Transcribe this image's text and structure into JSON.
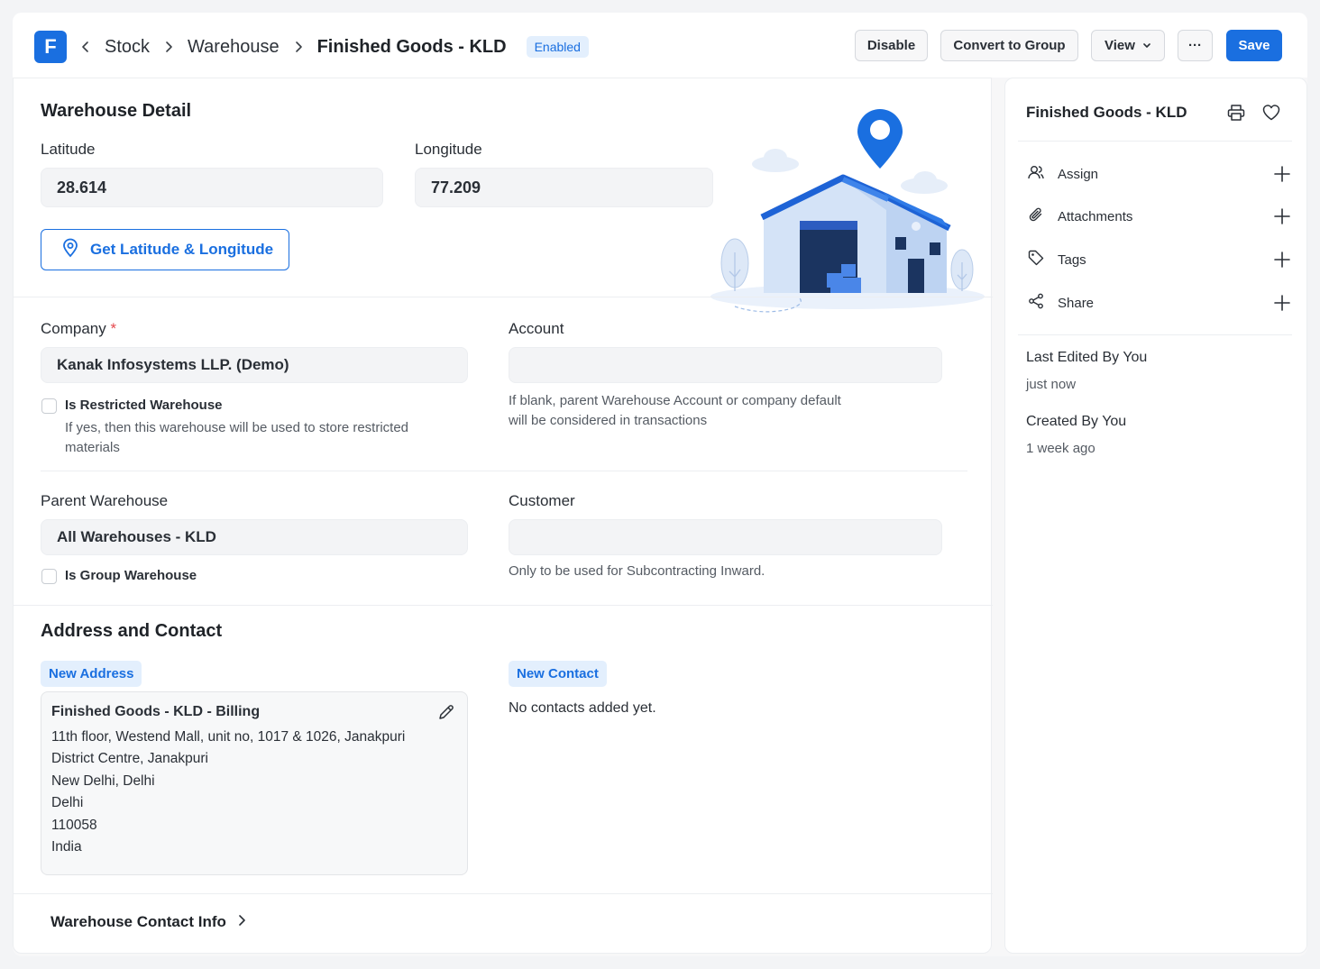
{
  "header": {
    "logo_letter": "F",
    "breadcrumbs": [
      "Stock",
      "Warehouse",
      "Finished Goods - KLD"
    ],
    "status": "Enabled",
    "buttons": {
      "disable": "Disable",
      "convert": "Convert to Group",
      "view": "View",
      "more": "···",
      "save": "Save"
    }
  },
  "warehouse_detail": {
    "title": "Warehouse Detail",
    "latitude_label": "Latitude",
    "latitude_value": "28.614",
    "longitude_label": "Longitude",
    "longitude_value": "77.209",
    "get_coords_button": "Get Latitude & Longitude"
  },
  "company_section": {
    "company_label": "Company",
    "required_mark": "*",
    "company_value": "Kanak Infosystems LLP. (Demo)",
    "restricted_label": "Is Restricted Warehouse",
    "restricted_help_1": "If yes, then this warehouse will be used to store restricted",
    "restricted_help_2": "materials",
    "account_label": "Account",
    "account_value": "",
    "account_help_1": "If blank, parent Warehouse Account or company default",
    "account_help_2": "will be considered in transactions"
  },
  "parent_section": {
    "parent_label": "Parent Warehouse",
    "parent_value": "All Warehouses - KLD",
    "group_label": "Is Group Warehouse",
    "customer_label": "Customer",
    "customer_value": "",
    "customer_help": "Only to be used for Subcontracting Inward."
  },
  "address_contact": {
    "title": "Address and Contact",
    "new_address": "New Address",
    "new_contact": "New Contact",
    "no_contacts": "No contacts added yet.",
    "address": {
      "title": "Finished Goods - KLD - Billing",
      "lines": [
        "11th floor, Westend Mall, unit no, 1017 & 1026, Janakpuri",
        "District Centre, Janakpuri",
        "New Delhi, Delhi",
        "Delhi",
        "110058",
        "India"
      ]
    }
  },
  "contact_info": {
    "label": "Warehouse Contact Info"
  },
  "sidebar": {
    "title": "Finished Goods - KLD",
    "items": [
      {
        "label": "Assign",
        "icon": "user-icon"
      },
      {
        "label": "Attachments",
        "icon": "paperclip-icon"
      },
      {
        "label": "Tags",
        "icon": "tag-icon"
      },
      {
        "label": "Share",
        "icon": "share-icon"
      }
    ],
    "last_edited_label": "Last Edited By You",
    "last_edited_time": "just now",
    "created_label": "Created By You",
    "created_time": "1 week ago"
  },
  "colors": {
    "accent": "#1a6fe0",
    "required": "#e5484d"
  }
}
